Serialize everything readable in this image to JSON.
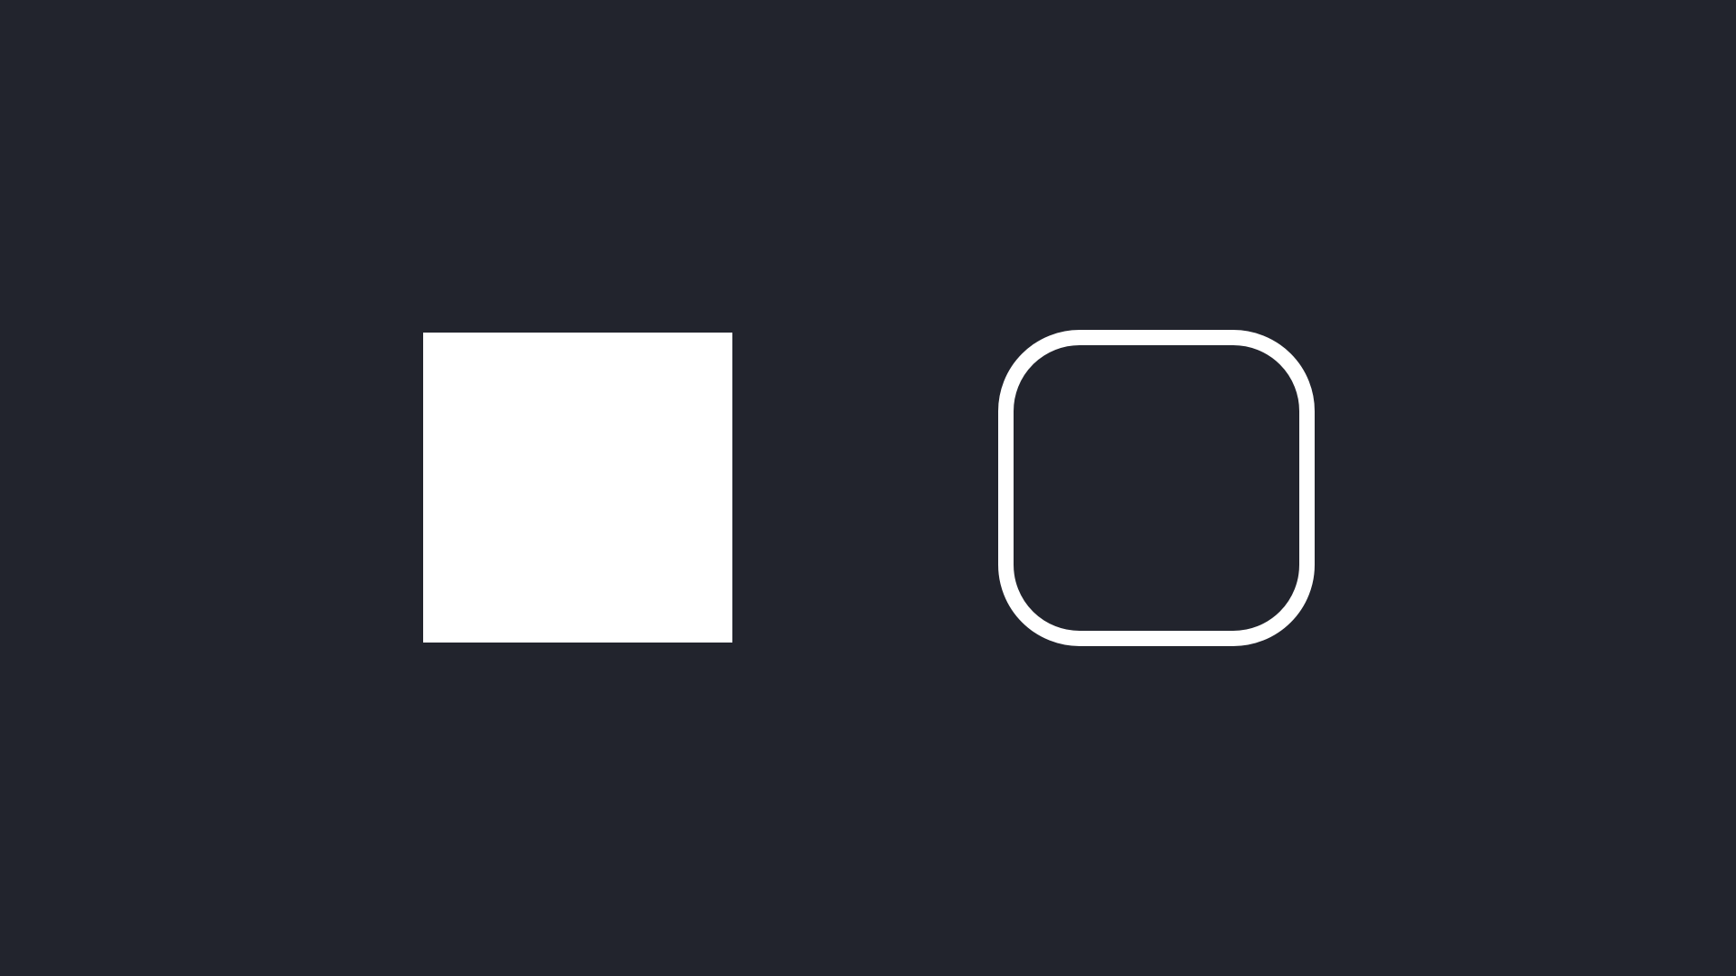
{
  "canvas": {
    "background_color": "#22242d"
  },
  "shapes": [
    {
      "name": "filled-square",
      "kind": "square",
      "style": "filled",
      "corners": "sharp",
      "color": "#ffffff"
    },
    {
      "name": "outlined-rounded-square",
      "kind": "square",
      "style": "outline",
      "corners": "rounded",
      "color": "#ffffff"
    }
  ]
}
